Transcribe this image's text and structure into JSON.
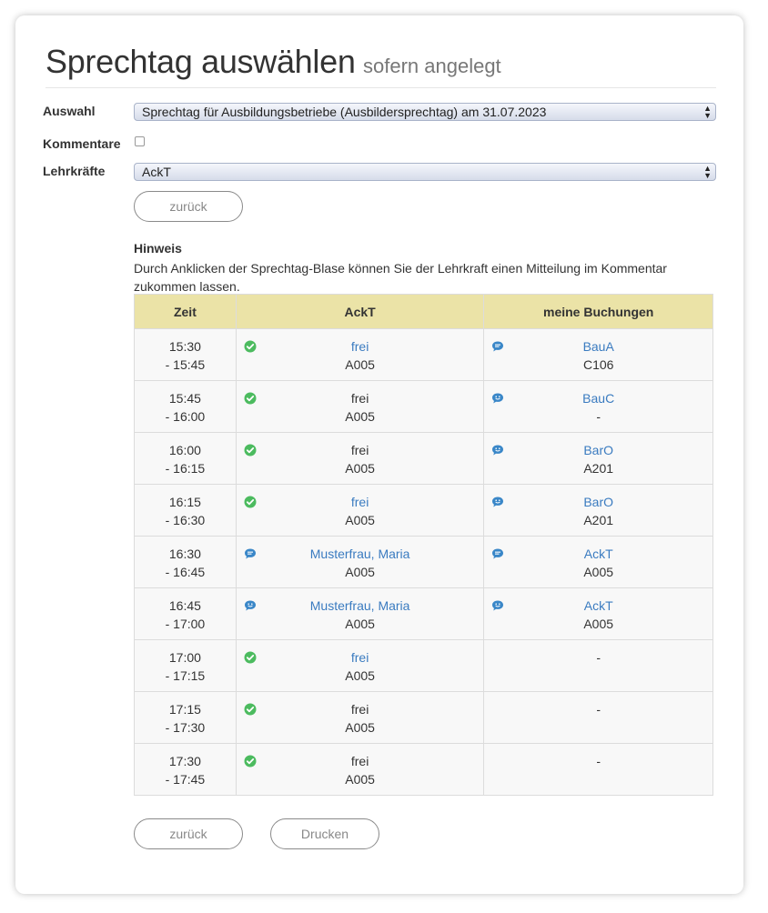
{
  "header": {
    "title": "Sprechtag auswählen",
    "subtitle": "sofern angelegt"
  },
  "form": {
    "auswahl_label": "Auswahl",
    "auswahl_value": "Sprechtag für Ausbildungsbetriebe (Ausbildersprechtag) am 31.07.2023",
    "kommentare_label": "Kommentare",
    "lehrkraefte_label": "Lehrkräfte",
    "lehrkraefte_value": "AckT"
  },
  "buttons": {
    "back": "zurück",
    "print": "Drucken"
  },
  "hint": {
    "title": "Hinweis",
    "text": "Durch Anklicken der Sprechtag-Blase können Sie der Lehrkraft einen Mitteilung im Kommentar zukommen lassen."
  },
  "table": {
    "headers": [
      "Zeit",
      "AckT",
      "meine Buchungen"
    ],
    "rows": [
      {
        "start": "15:30",
        "end": "- 15:45",
        "teacher_icon": "check-icon",
        "teacher_name": "frei",
        "teacher_link": true,
        "teacher_room": "A005",
        "booking_icon": "chat-bubble-icon",
        "booking_name": "BauA",
        "booking_room": "C106"
      },
      {
        "start": "15:45",
        "end": "- 16:00",
        "teacher_icon": "check-icon",
        "teacher_name": "frei",
        "teacher_link": false,
        "teacher_room": "A005",
        "booking_icon": "smile-bubble-icon",
        "booking_name": "BauC",
        "booking_room": "-"
      },
      {
        "start": "16:00",
        "end": "- 16:15",
        "teacher_icon": "check-icon",
        "teacher_name": "frei",
        "teacher_link": false,
        "teacher_room": "A005",
        "booking_icon": "smile-bubble-icon",
        "booking_name": "BarO",
        "booking_room": "A201"
      },
      {
        "start": "16:15",
        "end": "- 16:30",
        "teacher_icon": "check-icon",
        "teacher_name": "frei",
        "teacher_link": true,
        "teacher_room": "A005",
        "booking_icon": "smile-bubble-icon",
        "booking_name": "BarO",
        "booking_room": "A201"
      },
      {
        "start": "16:30",
        "end": "- 16:45",
        "teacher_icon": "chat-bubble-icon",
        "teacher_name": "Musterfrau, Maria",
        "teacher_link": true,
        "teacher_room": "A005",
        "booking_icon": "chat-bubble-icon",
        "booking_name": "AckT",
        "booking_room": "A005"
      },
      {
        "start": "16:45",
        "end": "- 17:00",
        "teacher_icon": "smile-bubble-icon",
        "teacher_name": "Musterfrau, Maria",
        "teacher_link": true,
        "teacher_room": "A005",
        "booking_icon": "smile-bubble-icon",
        "booking_name": "AckT",
        "booking_room": "A005"
      },
      {
        "start": "17:00",
        "end": "- 17:15",
        "teacher_icon": "check-icon",
        "teacher_name": "frei",
        "teacher_link": true,
        "teacher_room": "A005",
        "booking_icon": "",
        "booking_name": "-",
        "booking_room": ""
      },
      {
        "start": "17:15",
        "end": "- 17:30",
        "teacher_icon": "check-icon",
        "teacher_name": "frei",
        "teacher_link": false,
        "teacher_room": "A005",
        "booking_icon": "",
        "booking_name": "-",
        "booking_room": ""
      },
      {
        "start": "17:30",
        "end": "- 17:45",
        "teacher_icon": "check-icon",
        "teacher_name": "frei",
        "teacher_link": false,
        "teacher_room": "A005",
        "booking_icon": "",
        "booking_name": "-",
        "booking_room": ""
      }
    ]
  },
  "colors": {
    "header_bg": "#ebe3a7",
    "link": "#3a7bc0",
    "check": "#4cbb5f",
    "bubble": "#3a87c8"
  }
}
